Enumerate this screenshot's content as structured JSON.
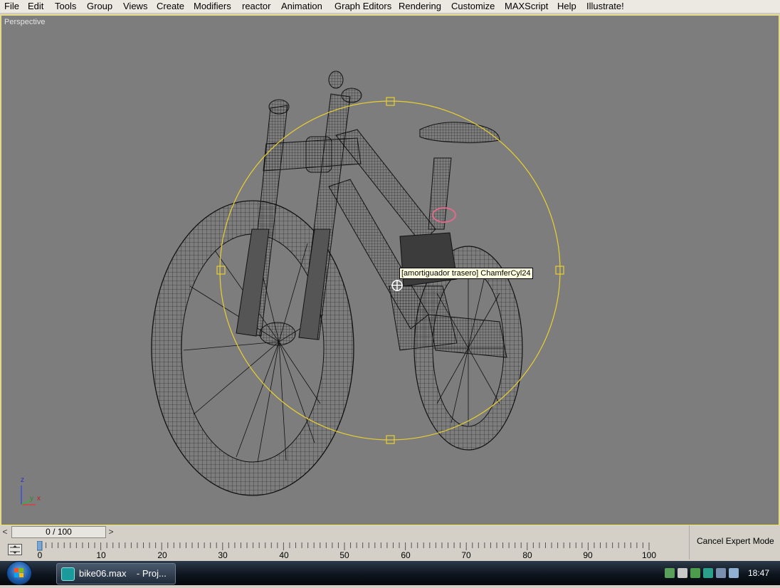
{
  "menubar": {
    "items": [
      {
        "id": "file",
        "label": "File"
      },
      {
        "id": "edit",
        "label": "Edit"
      },
      {
        "id": "tools",
        "label": "Tools"
      },
      {
        "id": "group",
        "label": "Group"
      },
      {
        "id": "views",
        "label": "Views"
      },
      {
        "id": "create",
        "label": "Create"
      },
      {
        "id": "modifiers",
        "label": "Modifiers"
      },
      {
        "id": "reactor",
        "label": "reactor"
      },
      {
        "id": "animation",
        "label": "Animation"
      },
      {
        "id": "graph-editors",
        "label": "Graph Editors"
      },
      {
        "id": "rendering",
        "label": "Rendering"
      },
      {
        "id": "customize",
        "label": "Customize"
      },
      {
        "id": "maxscript",
        "label": "MAXScript"
      },
      {
        "id": "help",
        "label": "Help"
      },
      {
        "id": "illustrate",
        "label": "Illustrate!"
      }
    ]
  },
  "viewport": {
    "label": "Perspective",
    "tooltip": "[amortiguador trasero] ChamferCyl24",
    "axes": {
      "z": "z",
      "y": "y",
      "x": "x"
    },
    "selection_color": "#e8d030",
    "background": "#7d7d7d"
  },
  "timeslider": {
    "value": "0 / 100",
    "prev": "<",
    "next": ">"
  },
  "trackbar": {
    "ticks": [
      "0",
      "10",
      "20",
      "30",
      "40",
      "50",
      "60",
      "70",
      "80",
      "90",
      "100"
    ]
  },
  "expert_mode": {
    "cancel_label": "Cancel Expert Mode"
  },
  "taskbar": {
    "task_label": "bike06.max    - Proj...",
    "clock": "18:47"
  }
}
